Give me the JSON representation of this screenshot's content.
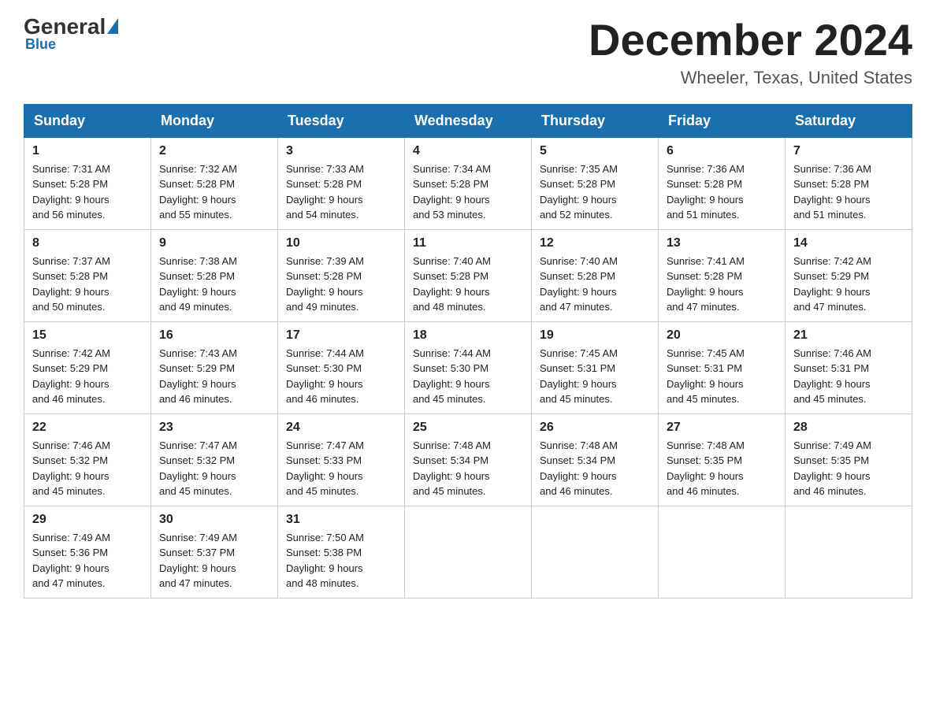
{
  "logo": {
    "general": "General",
    "blue": "Blue"
  },
  "title": "December 2024",
  "location": "Wheeler, Texas, United States",
  "days_of_week": [
    "Sunday",
    "Monday",
    "Tuesday",
    "Wednesday",
    "Thursday",
    "Friday",
    "Saturday"
  ],
  "weeks": [
    [
      {
        "day": "1",
        "info": "Sunrise: 7:31 AM\nSunset: 5:28 PM\nDaylight: 9 hours\nand 56 minutes."
      },
      {
        "day": "2",
        "info": "Sunrise: 7:32 AM\nSunset: 5:28 PM\nDaylight: 9 hours\nand 55 minutes."
      },
      {
        "day": "3",
        "info": "Sunrise: 7:33 AM\nSunset: 5:28 PM\nDaylight: 9 hours\nand 54 minutes."
      },
      {
        "day": "4",
        "info": "Sunrise: 7:34 AM\nSunset: 5:28 PM\nDaylight: 9 hours\nand 53 minutes."
      },
      {
        "day": "5",
        "info": "Sunrise: 7:35 AM\nSunset: 5:28 PM\nDaylight: 9 hours\nand 52 minutes."
      },
      {
        "day": "6",
        "info": "Sunrise: 7:36 AM\nSunset: 5:28 PM\nDaylight: 9 hours\nand 51 minutes."
      },
      {
        "day": "7",
        "info": "Sunrise: 7:36 AM\nSunset: 5:28 PM\nDaylight: 9 hours\nand 51 minutes."
      }
    ],
    [
      {
        "day": "8",
        "info": "Sunrise: 7:37 AM\nSunset: 5:28 PM\nDaylight: 9 hours\nand 50 minutes."
      },
      {
        "day": "9",
        "info": "Sunrise: 7:38 AM\nSunset: 5:28 PM\nDaylight: 9 hours\nand 49 minutes."
      },
      {
        "day": "10",
        "info": "Sunrise: 7:39 AM\nSunset: 5:28 PM\nDaylight: 9 hours\nand 49 minutes."
      },
      {
        "day": "11",
        "info": "Sunrise: 7:40 AM\nSunset: 5:28 PM\nDaylight: 9 hours\nand 48 minutes."
      },
      {
        "day": "12",
        "info": "Sunrise: 7:40 AM\nSunset: 5:28 PM\nDaylight: 9 hours\nand 47 minutes."
      },
      {
        "day": "13",
        "info": "Sunrise: 7:41 AM\nSunset: 5:28 PM\nDaylight: 9 hours\nand 47 minutes."
      },
      {
        "day": "14",
        "info": "Sunrise: 7:42 AM\nSunset: 5:29 PM\nDaylight: 9 hours\nand 47 minutes."
      }
    ],
    [
      {
        "day": "15",
        "info": "Sunrise: 7:42 AM\nSunset: 5:29 PM\nDaylight: 9 hours\nand 46 minutes."
      },
      {
        "day": "16",
        "info": "Sunrise: 7:43 AM\nSunset: 5:29 PM\nDaylight: 9 hours\nand 46 minutes."
      },
      {
        "day": "17",
        "info": "Sunrise: 7:44 AM\nSunset: 5:30 PM\nDaylight: 9 hours\nand 46 minutes."
      },
      {
        "day": "18",
        "info": "Sunrise: 7:44 AM\nSunset: 5:30 PM\nDaylight: 9 hours\nand 45 minutes."
      },
      {
        "day": "19",
        "info": "Sunrise: 7:45 AM\nSunset: 5:31 PM\nDaylight: 9 hours\nand 45 minutes."
      },
      {
        "day": "20",
        "info": "Sunrise: 7:45 AM\nSunset: 5:31 PM\nDaylight: 9 hours\nand 45 minutes."
      },
      {
        "day": "21",
        "info": "Sunrise: 7:46 AM\nSunset: 5:31 PM\nDaylight: 9 hours\nand 45 minutes."
      }
    ],
    [
      {
        "day": "22",
        "info": "Sunrise: 7:46 AM\nSunset: 5:32 PM\nDaylight: 9 hours\nand 45 minutes."
      },
      {
        "day": "23",
        "info": "Sunrise: 7:47 AM\nSunset: 5:32 PM\nDaylight: 9 hours\nand 45 minutes."
      },
      {
        "day": "24",
        "info": "Sunrise: 7:47 AM\nSunset: 5:33 PM\nDaylight: 9 hours\nand 45 minutes."
      },
      {
        "day": "25",
        "info": "Sunrise: 7:48 AM\nSunset: 5:34 PM\nDaylight: 9 hours\nand 45 minutes."
      },
      {
        "day": "26",
        "info": "Sunrise: 7:48 AM\nSunset: 5:34 PM\nDaylight: 9 hours\nand 46 minutes."
      },
      {
        "day": "27",
        "info": "Sunrise: 7:48 AM\nSunset: 5:35 PM\nDaylight: 9 hours\nand 46 minutes."
      },
      {
        "day": "28",
        "info": "Sunrise: 7:49 AM\nSunset: 5:35 PM\nDaylight: 9 hours\nand 46 minutes."
      }
    ],
    [
      {
        "day": "29",
        "info": "Sunrise: 7:49 AM\nSunset: 5:36 PM\nDaylight: 9 hours\nand 47 minutes."
      },
      {
        "day": "30",
        "info": "Sunrise: 7:49 AM\nSunset: 5:37 PM\nDaylight: 9 hours\nand 47 minutes."
      },
      {
        "day": "31",
        "info": "Sunrise: 7:50 AM\nSunset: 5:38 PM\nDaylight: 9 hours\nand 48 minutes."
      },
      {
        "day": "",
        "info": ""
      },
      {
        "day": "",
        "info": ""
      },
      {
        "day": "",
        "info": ""
      },
      {
        "day": "",
        "info": ""
      }
    ]
  ]
}
